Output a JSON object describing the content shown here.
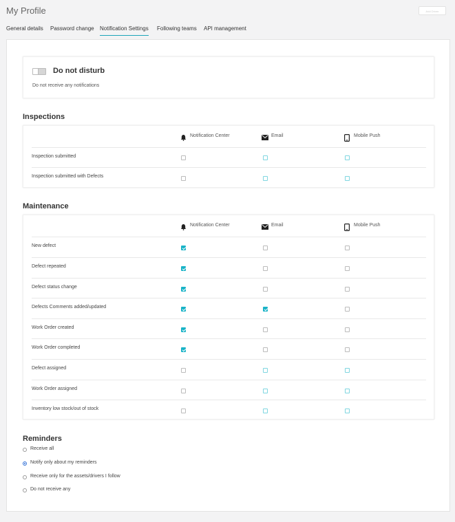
{
  "page": {
    "title": "My Profile",
    "top_button": "Add Driver"
  },
  "tabs": [
    {
      "label": "General details"
    },
    {
      "label": "Password change"
    },
    {
      "label": "Notification Settings",
      "active": true
    },
    {
      "label": "Following teams"
    },
    {
      "label": "API management"
    }
  ],
  "dnd": {
    "title": "Do not disturb",
    "subtitle": "Do not receive any notifications",
    "enabled": false
  },
  "columns": [
    {
      "label": "Notification Center",
      "icon": "bell-icon"
    },
    {
      "label": "Email",
      "icon": "envelope-icon"
    },
    {
      "label": "Mobile Push",
      "icon": "mobile-phone-icon"
    }
  ],
  "inspections": {
    "title": "Inspections",
    "rows": [
      {
        "label": "Inspection submitted",
        "values": [
          false,
          false,
          false
        ]
      },
      {
        "label": "Inspection submitted with Defects",
        "values": [
          false,
          false,
          false
        ]
      }
    ]
  },
  "maintenance": {
    "title": "Maintenance",
    "rows": [
      {
        "label": "New defect",
        "values": [
          true,
          false,
          false
        ]
      },
      {
        "label": "Defect repeated",
        "values": [
          true,
          false,
          false
        ]
      },
      {
        "label": "Defect status change",
        "values": [
          true,
          false,
          false
        ]
      },
      {
        "label": "Defects Comments added/updated",
        "values": [
          true,
          true,
          false
        ]
      },
      {
        "label": "Work Order created",
        "values": [
          true,
          false,
          false
        ]
      },
      {
        "label": "Work Order completed",
        "values": [
          true,
          false,
          false
        ]
      },
      {
        "label": "Defect assigned",
        "values": [
          false,
          false,
          false
        ]
      },
      {
        "label": "Work Order assigned",
        "values": [
          false,
          false,
          false
        ]
      },
      {
        "label": "Inventory low stock/out of stock",
        "values": [
          false,
          false,
          false
        ]
      }
    ]
  },
  "reminders": {
    "title": "Reminders",
    "options": [
      {
        "label": "Receive all",
        "selected": false
      },
      {
        "label": "Notify only about my reminders",
        "selected": true
      },
      {
        "label": "Receive only for the assets/drivers I follow",
        "selected": false
      },
      {
        "label": "Do not receive any",
        "selected": false
      }
    ]
  },
  "colors": {
    "accent": "#19b3c7",
    "radio": "#2f6fd6"
  }
}
